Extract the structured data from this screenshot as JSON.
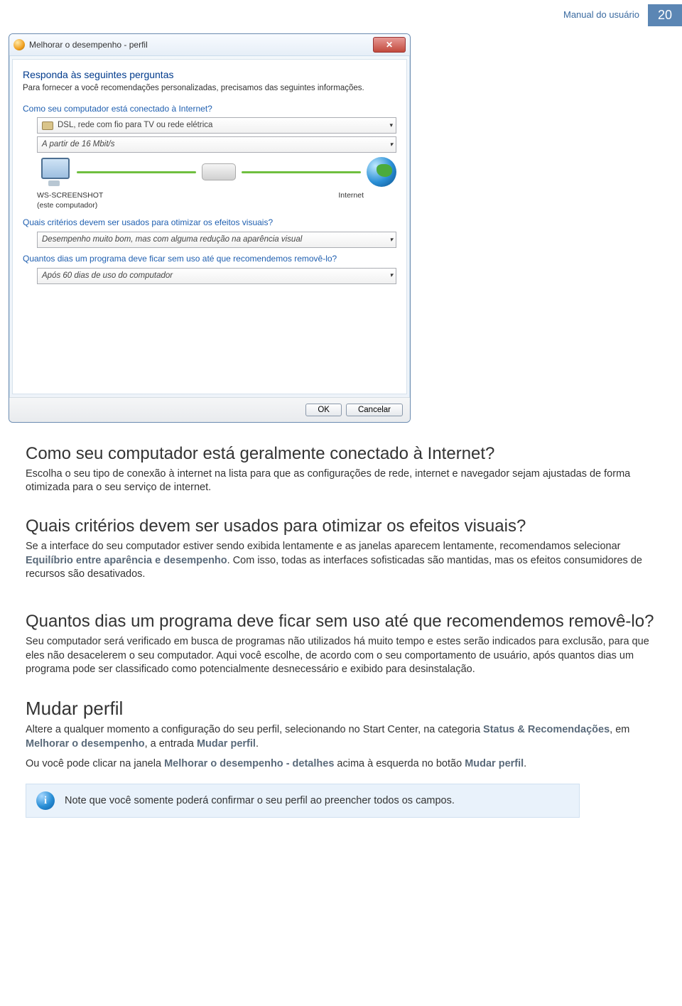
{
  "header": {
    "label": "Manual do usuário",
    "page": "20"
  },
  "dialog": {
    "title": "Melhorar o desempenho - perfil",
    "heading": "Responda às seguintes perguntas",
    "subtext": "Para fornecer a você recomendações personalizadas, precisamos das seguintes informações.",
    "q1_label": "Como seu computador está conectado à Internet?",
    "q1_drop1": "DSL, rede com fio para TV ou rede elétrica",
    "q1_drop2": "A partir de 16 Mbit/s",
    "net_computer": "WS-SCREENSHOT",
    "net_computer_sub": "(este computador)",
    "net_internet": "Internet",
    "q2_label": "Quais critérios devem ser usados para otimizar os efeitos visuais?",
    "q2_drop": "Desempenho muito bom, mas com alguma redução na aparência visual",
    "q3_label": "Quantos dias um programa deve ficar sem uso até que recomendemos removê-lo?",
    "q3_drop": "Após 60 dias de uso do computador",
    "ok": "OK",
    "cancel": "Cancelar"
  },
  "doc": {
    "s1_h": "Como seu computador está geralmente conectado à Internet?",
    "s1_p": "Escolha o seu tipo de conexão à internet na lista para que as configurações de rede, internet e navegador sejam ajustadas de forma otimizada para o seu serviço de internet.",
    "s2_h": "Quais critérios devem ser usados para otimizar os efeitos visuais?",
    "s2_p_pre": "Se a interface do seu computador estiver sendo exibida lentamente e as janelas aparecem lentamente, recomendamos selecionar ",
    "s2_bold": "Equilíbrio entre aparência e desempenho",
    "s2_p_post": ". Com isso, todas as interfaces sofisticadas são mantidas, mas os efeitos consumidores de recursos são desativados.",
    "s3_h": "Quantos dias um programa deve ficar sem uso até que recomendemos removê-lo?",
    "s3_p": "Seu computador será verificado em busca de programas não utilizados há muito tempo e estes serão indicados para exclusão, para que eles não desacelerem o seu computador. Aqui você escolhe, de acordo com o seu comportamento de usuário, após quantos dias um programa pode ser classificado como potencialmente desnecessário e exibido para desinstalação.",
    "s4_h": "Mudar perfil",
    "s4_p1_pre": "Altere a qualquer momento a configuração do seu perfil, selecionando no Start Center, na categoria ",
    "s4_b1": "Status & Recomendações",
    "s4_mid1": ", em ",
    "s4_b2": "Melhorar o desempenho",
    "s4_mid2": ", a entrada ",
    "s4_b3": "Mudar perfil",
    "s4_end": ".",
    "s4_p2_pre": "Ou você pode clicar na janela ",
    "s4_p2_b1": "Melhorar o desempenho - detalhes",
    "s4_p2_mid": " acima à esquerda no botão ",
    "s4_p2_b2": "Mudar perfil",
    "s4_p2_end": ".",
    "note": "Note que você somente poderá confirmar o seu perfil ao preencher todos os campos."
  }
}
